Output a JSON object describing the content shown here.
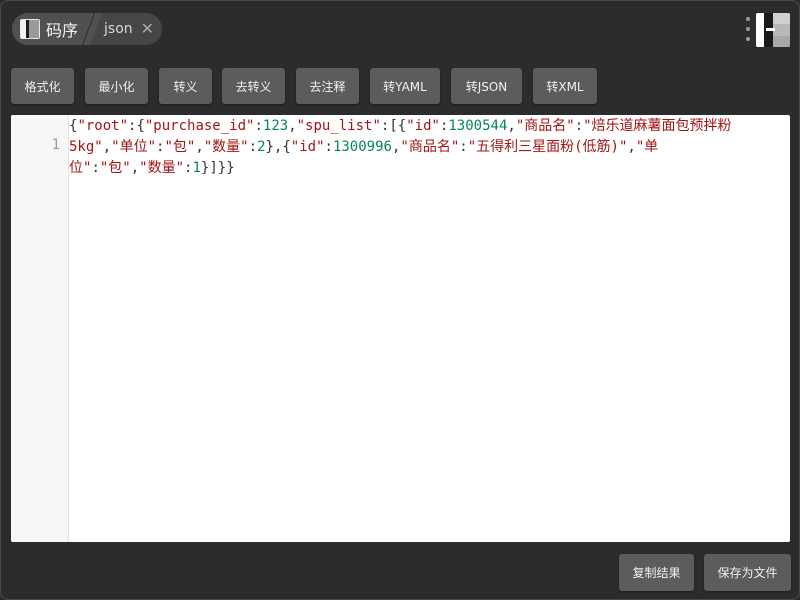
{
  "app": {
    "name": "码序",
    "current_tab": "json"
  },
  "toolbar": {
    "buttons": [
      "格式化",
      "最小化",
      "转义",
      "去转义",
      "去注释",
      "转YAML",
      "转JSON",
      "转XML"
    ]
  },
  "editor": {
    "line_number": "1",
    "tokens": [
      {
        "t": "{",
        "k": "punc"
      },
      {
        "t": "\"root\"",
        "k": "key"
      },
      {
        "t": ":{",
        "k": "punc"
      },
      {
        "t": "\"purchase_id\"",
        "k": "key"
      },
      {
        "t": ":",
        "k": "punc"
      },
      {
        "t": "123",
        "k": "num"
      },
      {
        "t": ",",
        "k": "punc"
      },
      {
        "t": "\"spu_list\"",
        "k": "key"
      },
      {
        "t": ":[{",
        "k": "punc"
      },
      {
        "t": "\"id\"",
        "k": "key"
      },
      {
        "t": ":",
        "k": "punc"
      },
      {
        "t": "1300544",
        "k": "num"
      },
      {
        "t": ",",
        "k": "punc"
      },
      {
        "t": "\"商品名\"",
        "k": "key"
      },
      {
        "t": ":",
        "k": "punc"
      },
      {
        "t": "\"焙乐道麻薯面包预拌粉5kg\"",
        "k": "str"
      },
      {
        "t": ",",
        "k": "punc"
      },
      {
        "t": "\"单位\"",
        "k": "key"
      },
      {
        "t": ":",
        "k": "punc"
      },
      {
        "t": "\"包\"",
        "k": "str"
      },
      {
        "t": ",",
        "k": "punc"
      },
      {
        "t": "\"数量\"",
        "k": "key"
      },
      {
        "t": ":",
        "k": "punc"
      },
      {
        "t": "2",
        "k": "num"
      },
      {
        "t": "},{",
        "k": "punc"
      },
      {
        "t": "\"id\"",
        "k": "key"
      },
      {
        "t": ":",
        "k": "punc"
      },
      {
        "t": "1300996",
        "k": "num"
      },
      {
        "t": ",",
        "k": "punc"
      },
      {
        "t": "\"商品名\"",
        "k": "key"
      },
      {
        "t": ":",
        "k": "punc"
      },
      {
        "t": "\"五得利三星面粉(低筋)\"",
        "k": "str"
      },
      {
        "t": ",",
        "k": "punc"
      },
      {
        "t": "\"单位\"",
        "k": "key"
      },
      {
        "t": ":",
        "k": "punc"
      },
      {
        "t": "\"包\"",
        "k": "str"
      },
      {
        "t": ",",
        "k": "punc"
      },
      {
        "t": "\"数量\"",
        "k": "key"
      },
      {
        "t": ":",
        "k": "punc"
      },
      {
        "t": "1",
        "k": "num"
      },
      {
        "t": "}]}}",
        "k": "punc"
      }
    ]
  },
  "footer": {
    "copy_label": "复制结果",
    "save_label": "保存为文件"
  }
}
